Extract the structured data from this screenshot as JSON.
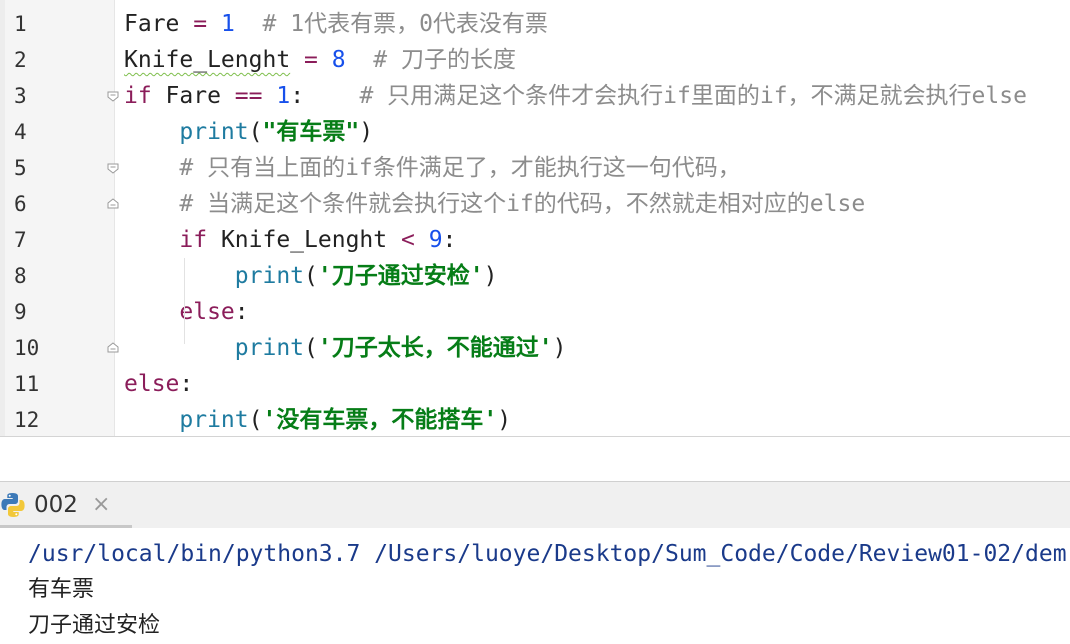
{
  "editor": {
    "lines": [
      {
        "no": "1",
        "tokens": [
          {
            "t": "Fare ",
            "c": ""
          },
          {
            "t": "=",
            "c": "op"
          },
          {
            "t": " ",
            "c": ""
          },
          {
            "t": "1",
            "c": "num"
          },
          {
            "t": "  # 1代表有票，0代表没有票",
            "c": "cm"
          }
        ]
      },
      {
        "no": "2",
        "tokens": [
          {
            "t": "Knife_Lenght",
            "c": "squiggle"
          },
          {
            "t": " ",
            "c": ""
          },
          {
            "t": "=",
            "c": "op"
          },
          {
            "t": " ",
            "c": ""
          },
          {
            "t": "8",
            "c": "num"
          },
          {
            "t": "  # 刀子的长度",
            "c": "cm"
          }
        ]
      },
      {
        "no": "3",
        "tokens": [
          {
            "t": "if",
            "c": "kw"
          },
          {
            "t": " Fare ",
            "c": ""
          },
          {
            "t": "==",
            "c": "op"
          },
          {
            "t": " ",
            "c": ""
          },
          {
            "t": "1",
            "c": "num"
          },
          {
            "t": ":    ",
            "c": ""
          },
          {
            "t": "# 只用满足这个条件才会执行if里面的if，不满足就会执行else",
            "c": "cm"
          }
        ]
      },
      {
        "no": "4",
        "tokens": [
          {
            "t": "    ",
            "c": ""
          },
          {
            "t": "print",
            "c": "fn"
          },
          {
            "t": "(",
            "c": ""
          },
          {
            "t": "\"有车票\"",
            "c": "str"
          },
          {
            "t": ")",
            "c": ""
          }
        ]
      },
      {
        "no": "5",
        "tokens": [
          {
            "t": "    ",
            "c": ""
          },
          {
            "t": "# 只有当上面的if条件满足了，才能执行这一句代码，",
            "c": "cm"
          }
        ]
      },
      {
        "no": "6",
        "tokens": [
          {
            "t": "    ",
            "c": ""
          },
          {
            "t": "# 当满足这个条件就会执行这个if的代码，不然就走相对应的else",
            "c": "cm"
          }
        ]
      },
      {
        "no": "7",
        "tokens": [
          {
            "t": "    ",
            "c": ""
          },
          {
            "t": "if",
            "c": "kw"
          },
          {
            "t": " Knife_Lenght ",
            "c": ""
          },
          {
            "t": "<",
            "c": "op"
          },
          {
            "t": " ",
            "c": ""
          },
          {
            "t": "9",
            "c": "num"
          },
          {
            "t": ":",
            "c": ""
          }
        ]
      },
      {
        "no": "8",
        "tokens": [
          {
            "t": "        ",
            "c": ""
          },
          {
            "t": "print",
            "c": "fn"
          },
          {
            "t": "(",
            "c": ""
          },
          {
            "t": "'刀子通过安检'",
            "c": "str"
          },
          {
            "t": ")",
            "c": ""
          }
        ]
      },
      {
        "no": "9",
        "tokens": [
          {
            "t": "    ",
            "c": ""
          },
          {
            "t": "else",
            "c": "kw"
          },
          {
            "t": ":",
            "c": ""
          }
        ]
      },
      {
        "no": "10",
        "tokens": [
          {
            "t": "        ",
            "c": ""
          },
          {
            "t": "print",
            "c": "fn"
          },
          {
            "t": "(",
            "c": ""
          },
          {
            "t": "'刀子太长，不能通过'",
            "c": "str"
          },
          {
            "t": ")",
            "c": ""
          }
        ]
      },
      {
        "no": "11",
        "tokens": [
          {
            "t": "else",
            "c": "kw"
          },
          {
            "t": ":",
            "c": ""
          }
        ]
      },
      {
        "no": "12",
        "tokens": [
          {
            "t": "    ",
            "c": ""
          },
          {
            "t": "print",
            "c": "fn"
          },
          {
            "t": "(",
            "c": ""
          },
          {
            "t": "'没有车票，不能搭车'",
            "c": "str"
          },
          {
            "t": ")",
            "c": ""
          }
        ]
      }
    ]
  },
  "run_tab": {
    "label": "002",
    "close": "×",
    "icon": "python-icon"
  },
  "console": {
    "command": "/usr/local/bin/python3.7 /Users/luoye/Desktop/Sum_Code/Code/Review01-02/dem",
    "output": [
      "有车票",
      "刀子通过安检"
    ]
  },
  "colors": {
    "keyword": "#8b1d5a",
    "number": "#1750eb",
    "comment": "#8c8c8c",
    "string": "#067d17",
    "builtin": "#1e7ba0"
  }
}
